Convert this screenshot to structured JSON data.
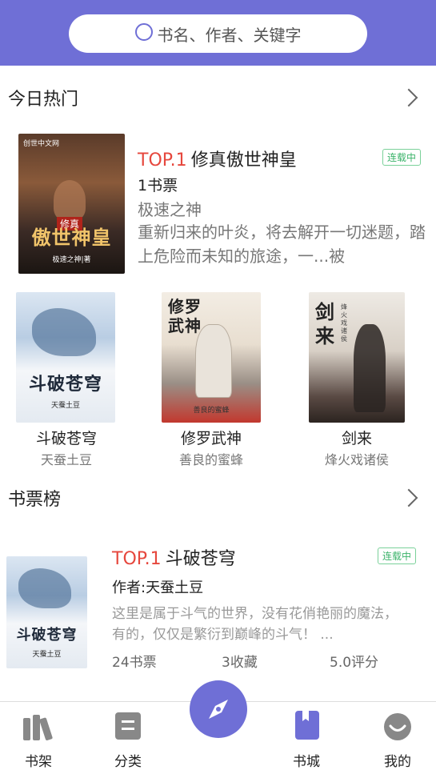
{
  "search": {
    "placeholder": "书名、作者、关键字"
  },
  "hot": {
    "title": "今日热门",
    "featured": {
      "rank": "TOP.1",
      "title": "修真傲世神皇",
      "tickets": "1书票",
      "author": "极速之神",
      "desc": "重新归来的叶炎，将去解开一切迷题，踏上危险而未知的旅途，一...被",
      "status": "连载中",
      "cover_text": "傲世神皇",
      "cover_tag": "修真",
      "cover_sub": "极速之神|著",
      "cover_logo": "创世中文网"
    },
    "grid": [
      {
        "title": "斗破苍穹",
        "author": "天蚕土豆",
        "cover_text": "斗破苍穹",
        "cover_sub": "天蚕土豆"
      },
      {
        "title": "修罗武神",
        "author": "善良的蜜蜂",
        "cover_text": "修罗武神",
        "cover_sub": "善良的蜜蜂"
      },
      {
        "title": "剑来",
        "author": "烽火戏诸侯",
        "cover_text": "剑来",
        "cover_sub": "烽火戏诸侯"
      }
    ]
  },
  "ticket_rank": {
    "title": "书票榜",
    "item": {
      "rank": "TOP.1",
      "title": "斗破苍穹",
      "author": "作者:天蚕土豆",
      "desc": "这里是属于斗气的世界，没有花俏艳丽的魔法，有的，仅仅是繁衍到巅峰的斗气！ ...",
      "tickets": "24书票",
      "favorites": "3收藏",
      "rating": "5.0评分",
      "status": "连载中",
      "cover_text": "斗破苍穹",
      "cover_sub": "天蚕土豆"
    }
  },
  "tabs": [
    {
      "label": "书架",
      "icon": "bookshelf-icon"
    },
    {
      "label": "分类",
      "icon": "category-icon"
    },
    {
      "label": "",
      "icon": "compass-icon"
    },
    {
      "label": "书城",
      "icon": "bookstore-icon"
    },
    {
      "label": "我的",
      "icon": "profile-icon"
    }
  ],
  "colors": {
    "accent": "#6f6fd6",
    "rank_red": "#e6473d",
    "badge_green": "#3bb36a"
  }
}
